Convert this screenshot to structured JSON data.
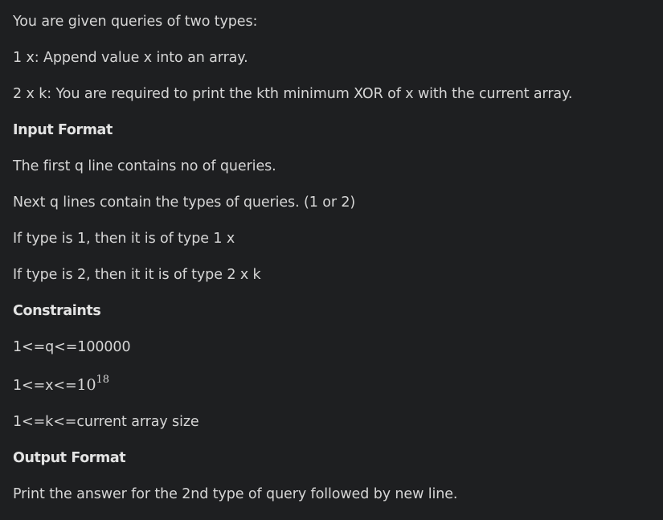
{
  "problem": {
    "intro": "You are given queries of two types:",
    "query1": "1 x: Append value x into an array.",
    "query2": "2 x k: You are required to print the kth minimum XOR of x with the current array.",
    "input_heading": "Input Format",
    "input_line1": "The first q line contains no of queries.",
    "input_line2": "Next q lines contain the types of queries. (1 or 2)",
    "input_line3": "If type is 1, then it is of type 1 x",
    "input_line4": "If type is 2, then it it is of type 2 x k",
    "constraints_heading": "Constraints",
    "constraint_q": "1<=q<=100000",
    "constraint_x_prefix": "1<=x<=",
    "constraint_x_base": "10",
    "constraint_x_exp": "18",
    "constraint_k": "1<=k<=current array size",
    "output_heading": "Output Format",
    "output_line": "Print the answer for the 2nd type of query followed by new line."
  }
}
